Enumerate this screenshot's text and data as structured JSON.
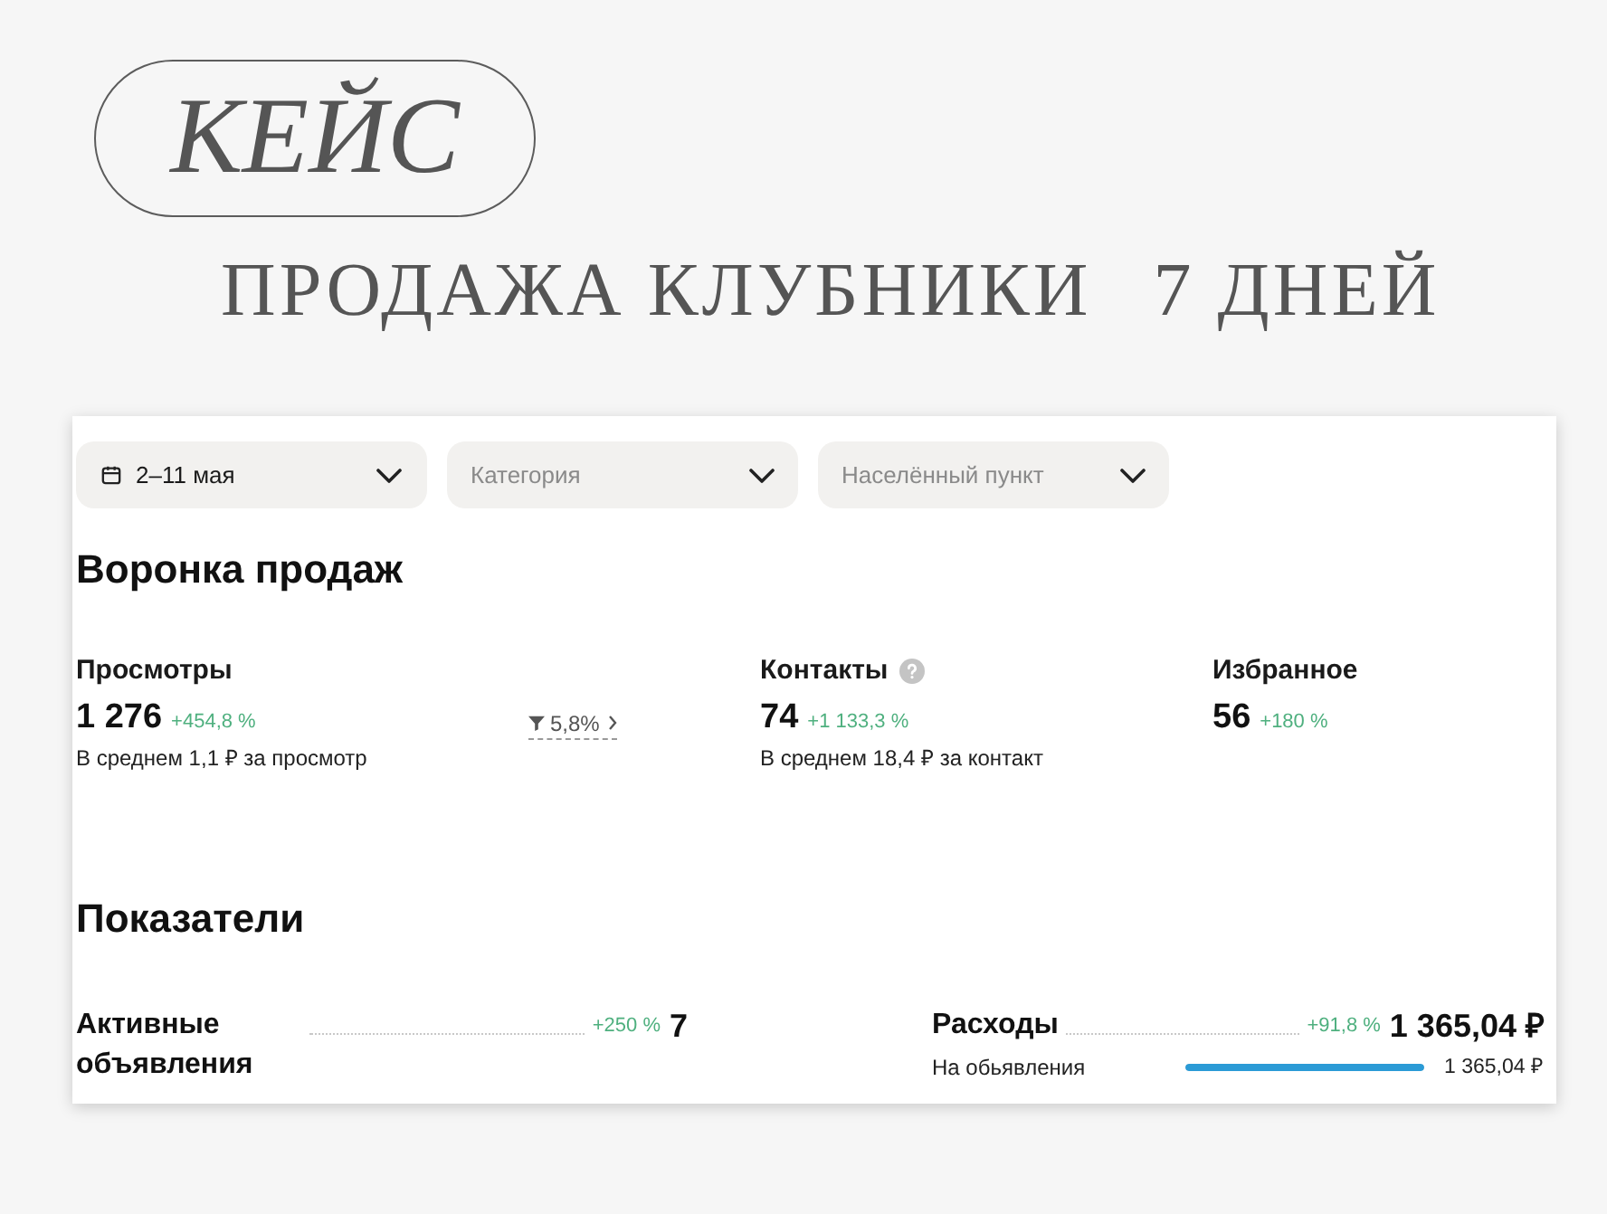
{
  "header": {
    "badge": "КЕЙС",
    "title": [
      "ПРОДАЖА КЛУБНИКИ",
      "7 ДНЕЙ"
    ]
  },
  "filters": [
    {
      "kind": "date",
      "value": "2–11 мая"
    },
    {
      "kind": "select",
      "placeholder": "Категория"
    },
    {
      "kind": "select",
      "placeholder": "Населённый пункт"
    }
  ],
  "funnel": {
    "title": "Воронка продаж",
    "items": [
      {
        "kind": "metric",
        "label": "Просмотры",
        "help": false,
        "value": "1 276",
        "change": "+454,8 %",
        "note": "В среднем 1,1 ₽ за просмотр"
      },
      {
        "kind": "conversion",
        "value": "5,8%"
      },
      {
        "kind": "metric",
        "label": "Контакты",
        "help": true,
        "value": "74",
        "change": "+1 133,3 %",
        "note": "В среднем 18,4 ₽ за контакт"
      },
      {
        "kind": "metric",
        "label": "Избранное",
        "help": false,
        "value": "56",
        "change": "+180 %"
      }
    ]
  },
  "indicators": {
    "title": "Показатели",
    "items": [
      {
        "label": "Активные объявления",
        "change": "+250 %",
        "value": "7"
      },
      {
        "label": "Расходы",
        "change": "+91,8 %",
        "value": "1 365,04 ₽",
        "breakdown": [
          {
            "label": "На обьявления",
            "level": 1,
            "value": "1 365,04 ₽"
          }
        ]
      }
    ]
  }
}
